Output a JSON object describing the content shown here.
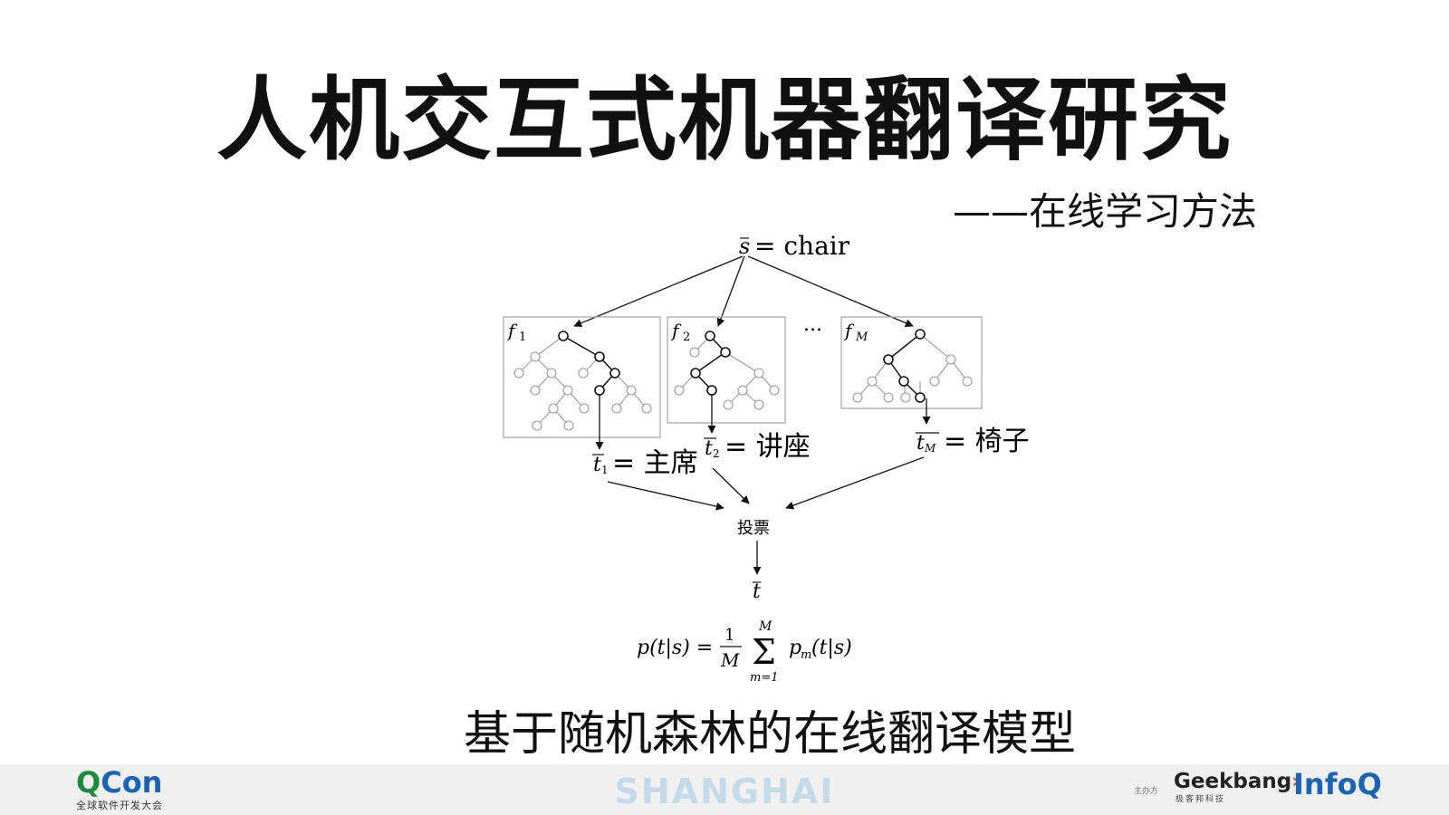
{
  "slide": {
    "title": "人机交互式机器翻译研究",
    "subtitle": "——在线学习方法",
    "caption": "基于随机森林的在线翻译模型"
  },
  "diagram": {
    "source": {
      "label": "= chair",
      "symbol": "s"
    },
    "trees": [
      {
        "label": "f",
        "sub": "1"
      },
      {
        "label": "f",
        "sub": "2"
      },
      {
        "label": "f",
        "sub": "M"
      }
    ],
    "ellipsis": "...",
    "outputs": [
      {
        "symbol": "t",
        "sub": "1",
        "text": "= 主席"
      },
      {
        "symbol": "t",
        "sub": "2",
        "text": "= 讲座"
      },
      {
        "symbol": "t",
        "sub": "M",
        "text": "= 椅子"
      }
    ],
    "vote": "投票",
    "result": "t",
    "formula": {
      "lhs": "p(t|s) =",
      "frac_num": "1",
      "frac_den": "M",
      "sum": "Σ",
      "sum_top": "M",
      "sum_bottom": "m=1",
      "rhs": "p",
      "rhs_sub": "m",
      "rhs_args": "(t|s)"
    }
  },
  "footer": {
    "qcon_main_1": "Q",
    "qcon_main_2": "Con",
    "qcon_sub": "全球软件开发大会",
    "city": "SHANGHAI",
    "organizer": "主办方",
    "geek_1": "Geek",
    "geek_2": "bang",
    "geek_arrow": "›",
    "geek_sub": "极客邦科技",
    "infoq": "InfoQ"
  }
}
